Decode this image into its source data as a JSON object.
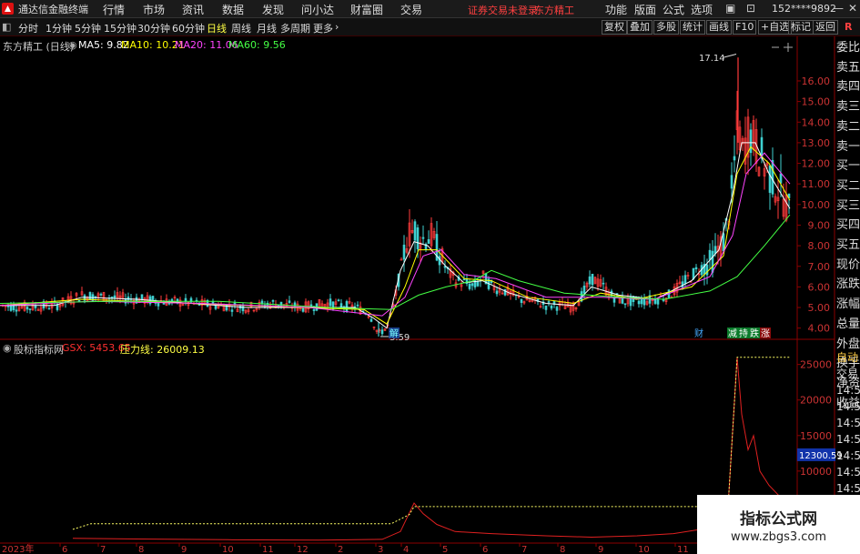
{
  "titlebar": {
    "app_title": "通达信金融终端",
    "menus": [
      "行情",
      "市场",
      "资讯",
      "数据",
      "发现",
      "问小达",
      "财富圈",
      "交易"
    ],
    "notice": "证券交易未登录",
    "stock": "东方精工",
    "right_menus": [
      "功能",
      "版面",
      "公式",
      "选项"
    ],
    "user": "152****9892"
  },
  "tabbar": {
    "periods": [
      "分时",
      "1分钟",
      "5分钟",
      "15分钟",
      "30分钟",
      "60分钟",
      "日线",
      "周线",
      "月线",
      "多周期",
      "更多"
    ],
    "active": "日线",
    "tools": [
      "复权",
      "叠加",
      "多股",
      "统计",
      "画线",
      "F10",
      "+自选",
      "标记",
      "返回"
    ],
    "corner": "R"
  },
  "main": {
    "title": "东方精工 (日线)",
    "ma": [
      {
        "label": "MA5: 9.82",
        "color": "#ffffff"
      },
      {
        "label": "MA10: 10.21",
        "color": "#ffff00"
      },
      {
        "label": "MA20: 11.06",
        "color": "#ff44ff"
      },
      {
        "label": "MA60: 9.56",
        "color": "#44ff44"
      }
    ],
    "high_label": "17.14",
    "low_label": "3.59",
    "y_ticks": [
      "16.00",
      "15.00",
      "14.00",
      "13.00",
      "12.00",
      "11.00",
      "10.00",
      "9.00",
      "8.00",
      "7.00",
      "6.00",
      "5.00",
      "4.00"
    ],
    "markers": [
      "解",
      "财",
      "减",
      "持",
      "跌",
      "涨"
    ]
  },
  "sub": {
    "site": "股标指标网",
    "gsx_label": "GSX: 5453.65",
    "pressure_label": "压力线: 26009.13",
    "y_ticks": [
      "25000",
      "20000",
      "15000",
      "10000"
    ],
    "current_value": "12300.59"
  },
  "x_axis": [
    "2023年",
    "6",
    "7",
    "8",
    "9",
    "10",
    "11",
    "12",
    "2",
    "3",
    "4",
    "5",
    "6",
    "7",
    "8",
    "9",
    "10",
    "11"
  ],
  "side_panel": {
    "labels": [
      "委比",
      "卖五",
      "卖四",
      "卖三",
      "卖二",
      "卖一",
      "买一",
      "买二",
      "买三",
      "买四",
      "买五",
      "现价",
      "涨跌",
      "涨幅",
      "总量",
      "外盘",
      "换手",
      "净资",
      "收益"
    ],
    "bottom_labels": [
      "自动",
      "交易",
      "14:56",
      "14:56",
      "14:56",
      "14:56",
      "14:56",
      "14:56",
      "14:56"
    ]
  },
  "watermark": {
    "line1": "指标公式网",
    "line2": "www.zbgs3.com"
  },
  "chart_data": {
    "type": "candlestick",
    "price_range": [
      3.5,
      17.5
    ],
    "price_ticks": [
      4,
      5,
      6,
      7,
      8,
      9,
      10,
      11,
      12,
      13,
      14,
      15,
      16
    ],
    "price_path": [
      [
        0,
        5.1
      ],
      [
        30,
        5.0
      ],
      [
        60,
        5.1
      ],
      [
        90,
        5.6
      ],
      [
        120,
        5.5
      ],
      [
        150,
        5.4
      ],
      [
        180,
        5.3
      ],
      [
        210,
        5.2
      ],
      [
        240,
        5.1
      ],
      [
        270,
        5.0
      ],
      [
        300,
        5.2
      ],
      [
        330,
        5.0
      ],
      [
        360,
        5.2
      ],
      [
        390,
        5.0
      ],
      [
        405,
        4.7
      ],
      [
        415,
        3.7
      ],
      [
        425,
        4.1
      ],
      [
        432,
        5.2
      ],
      [
        440,
        7.0
      ],
      [
        447,
        8.5
      ],
      [
        455,
        8.8
      ],
      [
        463,
        8.3
      ],
      [
        472,
        8.5
      ],
      [
        480,
        7.8
      ],
      [
        490,
        6.8
      ],
      [
        500,
        6.3
      ],
      [
        510,
        6.2
      ],
      [
        520,
        6.0
      ],
      [
        530,
        6.5
      ],
      [
        540,
        6.0
      ],
      [
        555,
        5.8
      ],
      [
        570,
        5.4
      ],
      [
        585,
        5.3
      ],
      [
        600,
        5.1
      ],
      [
        615,
        5.1
      ],
      [
        630,
        5.0
      ],
      [
        640,
        5.7
      ],
      [
        650,
        6.4
      ],
      [
        660,
        6.1
      ],
      [
        670,
        5.6
      ],
      [
        685,
        5.3
      ],
      [
        700,
        5.3
      ],
      [
        720,
        5.4
      ],
      [
        735,
        5.6
      ],
      [
        750,
        6.2
      ],
      [
        765,
        6.8
      ],
      [
        780,
        7.2
      ],
      [
        795,
        8.3
      ],
      [
        803,
        10.5
      ],
      [
        810,
        14.0
      ],
      [
        815,
        12.5
      ],
      [
        822,
        13.6
      ],
      [
        830,
        12.8
      ],
      [
        838,
        12.0
      ],
      [
        848,
        11.2
      ],
      [
        858,
        10.5
      ],
      [
        868,
        9.5
      ]
    ],
    "ma5": [
      [
        0,
        5.1
      ],
      [
        60,
        5.1
      ],
      [
        90,
        5.5
      ],
      [
        150,
        5.4
      ],
      [
        210,
        5.2
      ],
      [
        270,
        5.0
      ],
      [
        330,
        5.0
      ],
      [
        390,
        5.0
      ],
      [
        410,
        4.5
      ],
      [
        425,
        4.0
      ],
      [
        440,
        6.8
      ],
      [
        455,
        8.2
      ],
      [
        470,
        8.0
      ],
      [
        490,
        7.0
      ],
      [
        510,
        6.2
      ],
      [
        530,
        6.3
      ],
      [
        560,
        5.7
      ],
      [
        600,
        5.2
      ],
      [
        630,
        5.1
      ],
      [
        650,
        6.0
      ],
      [
        680,
        5.6
      ],
      [
        720,
        5.4
      ],
      [
        760,
        6.3
      ],
      [
        790,
        7.8
      ],
      [
        805,
        10.5
      ],
      [
        815,
        13.0
      ],
      [
        830,
        13.0
      ],
      [
        845,
        11.5
      ],
      [
        868,
        9.8
      ]
    ],
    "ma10": [
      [
        0,
        5.1
      ],
      [
        90,
        5.4
      ],
      [
        210,
        5.2
      ],
      [
        330,
        5.0
      ],
      [
        400,
        4.9
      ],
      [
        425,
        4.2
      ],
      [
        445,
        6.0
      ],
      [
        460,
        7.8
      ],
      [
        480,
        7.8
      ],
      [
        510,
        6.4
      ],
      [
        540,
        6.3
      ],
      [
        580,
        5.5
      ],
      [
        630,
        5.2
      ],
      [
        660,
        5.7
      ],
      [
        700,
        5.4
      ],
      [
        760,
        6.0
      ],
      [
        795,
        7.5
      ],
      [
        810,
        11.5
      ],
      [
        825,
        12.8
      ],
      [
        845,
        12.0
      ],
      [
        868,
        10.2
      ]
    ],
    "ma20": [
      [
        0,
        5.1
      ],
      [
        100,
        5.3
      ],
      [
        220,
        5.2
      ],
      [
        340,
        5.0
      ],
      [
        420,
        4.6
      ],
      [
        445,
        5.5
      ],
      [
        465,
        7.5
      ],
      [
        485,
        7.8
      ],
      [
        510,
        6.6
      ],
      [
        545,
        6.4
      ],
      [
        600,
        5.5
      ],
      [
        660,
        5.5
      ],
      [
        720,
        5.4
      ],
      [
        780,
        6.5
      ],
      [
        805,
        8.5
      ],
      [
        820,
        11.5
      ],
      [
        840,
        12.5
      ],
      [
        868,
        11.0
      ]
    ],
    "ma60": [
      [
        0,
        5.2
      ],
      [
        120,
        5.3
      ],
      [
        240,
        5.3
      ],
      [
        360,
        5.0
      ],
      [
        430,
        4.9
      ],
      [
        460,
        5.6
      ],
      [
        490,
        6.0
      ],
      [
        520,
        6.3
      ],
      [
        540,
        6.8
      ],
      [
        570,
        6.3
      ],
      [
        620,
        5.7
      ],
      [
        680,
        5.5
      ],
      [
        730,
        5.4
      ],
      [
        780,
        5.8
      ],
      [
        810,
        6.5
      ],
      [
        840,
        8.0
      ],
      [
        868,
        9.5
      ]
    ],
    "gsx_range": [
      0,
      27000
    ],
    "gsx_ticks": [
      10000,
      15000,
      20000,
      25000
    ],
    "gsx": [
      [
        80,
        550
      ],
      [
        150,
        450
      ],
      [
        250,
        350
      ],
      [
        350,
        300
      ],
      [
        420,
        400
      ],
      [
        440,
        1500
      ],
      [
        455,
        5500
      ],
      [
        465,
        4000
      ],
      [
        480,
        2500
      ],
      [
        500,
        1500
      ],
      [
        540,
        1200
      ],
      [
        600,
        900
      ],
      [
        650,
        700
      ],
      [
        700,
        900
      ],
      [
        740,
        1200
      ],
      [
        770,
        1800
      ],
      [
        800,
        5000
      ],
      [
        810,
        26000
      ],
      [
        815,
        18000
      ],
      [
        822,
        13000
      ],
      [
        828,
        15000
      ],
      [
        835,
        10000
      ],
      [
        845,
        8000
      ],
      [
        860,
        6000
      ],
      [
        870,
        5400
      ]
    ],
    "pressure": [
      [
        80,
        1800
      ],
      [
        100,
        2600
      ],
      [
        430,
        2600
      ],
      [
        450,
        3900
      ],
      [
        455,
        5000
      ],
      [
        800,
        5000
      ],
      [
        810,
        26000
      ],
      [
        868,
        26000
      ]
    ]
  }
}
